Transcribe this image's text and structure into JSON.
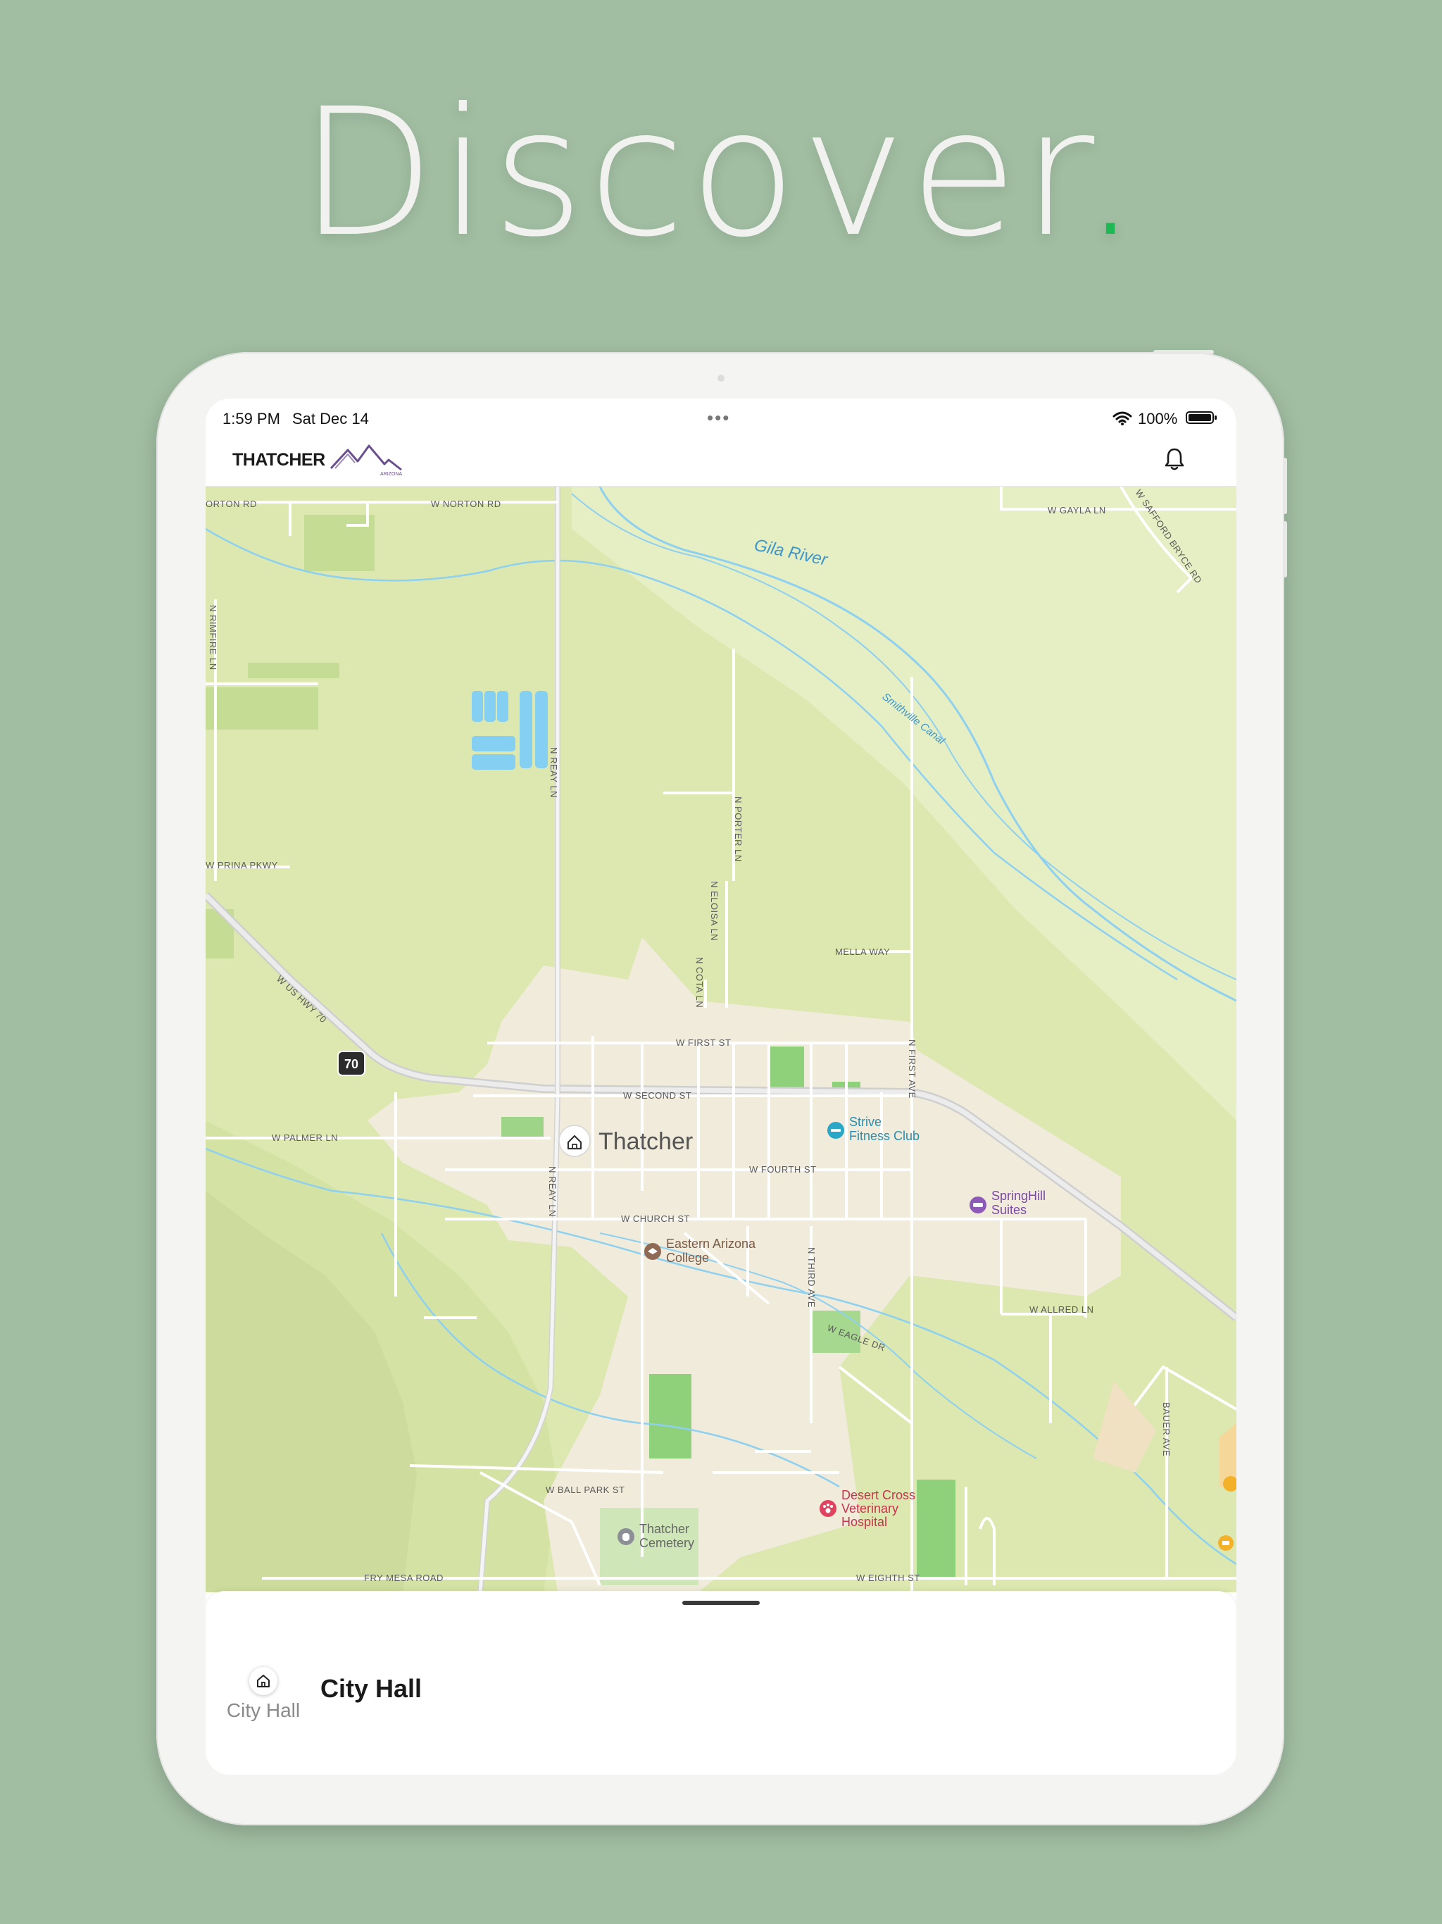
{
  "headline": {
    "text": "Discover",
    "dot": "."
  },
  "status_bar": {
    "time": "1:59 PM",
    "date": "Sat Dec 14",
    "battery": "100%"
  },
  "header": {
    "logo_text": "THATCHER",
    "logo_subtext": "ARIZONA"
  },
  "map": {
    "town_label": "Thatcher",
    "water": {
      "river": "Gila River",
      "canal": "Smithville Canal"
    },
    "roads": {
      "norton_w": "ORTON RD",
      "norton": "W NORTON RD",
      "gayla": "W GAYLA LN",
      "safford_bryce": "W SAFFORD BRYCE RD",
      "rimfire": "N RIMFIRE LN",
      "reay": "N REAY LN",
      "reay_south": "N REAY LN",
      "prina": "W PRINA PKWY",
      "porter": "N PORTER LN",
      "eloisa": "N ELOISA LN",
      "cota": "N COTA LN",
      "mella": "MELLA WAY",
      "hwy70": "W US HWY 70",
      "hwy_shield": "70",
      "first_st": "W FIRST ST",
      "first_ave": "N FIRST AVE",
      "second": "W SECOND ST",
      "palmer": "W PALMER LN",
      "fourth": "W FOURTH ST",
      "church": "W CHURCH ST",
      "third_ave": "N THIRD AVE",
      "eagle": "W EAGLE DR",
      "allred": "W ALLRED LN",
      "bauer": "BAUER AVE",
      "ball_park": "W BALL PARK ST",
      "fry_mesa": "FRY MESA ROAD",
      "eighth": "W EIGHTH ST"
    },
    "pois": {
      "strive": [
        "Strive",
        "Fitness Club"
      ],
      "springhill": [
        "SpringHill",
        "Suites"
      ],
      "eac": [
        "Eastern Arizona",
        "College"
      ],
      "cemetery": [
        "Thatcher",
        "Cemetery"
      ],
      "vet": [
        "Desert Cross",
        "Veterinary",
        "Hospital"
      ]
    },
    "colors": {
      "land": "#dfe8b5",
      "water": "#7dc8ee",
      "urban": "#f1ecdf",
      "park": "#8fd07a",
      "road": "#ffffff"
    }
  },
  "sheet": {
    "category_label": "City Hall",
    "title": "City Hall"
  },
  "icons": {
    "home": "home-icon",
    "bell": "bell-icon",
    "wifi": "wifi-icon",
    "battery": "battery-icon"
  }
}
